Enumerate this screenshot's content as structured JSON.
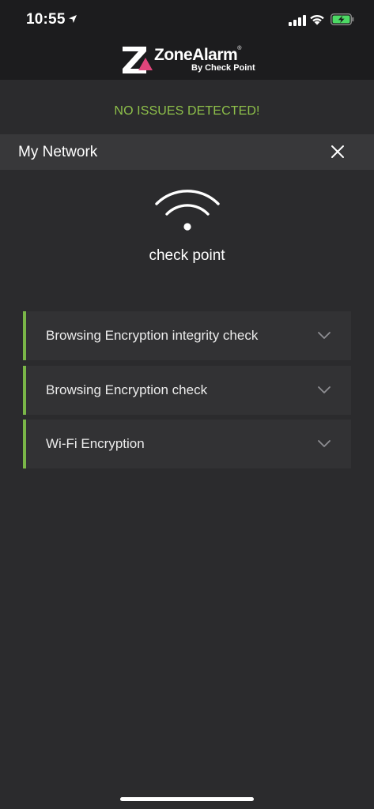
{
  "status_bar": {
    "time": "10:55",
    "location_icon": "location-arrow-icon",
    "signal_icon": "cellular-signal-icon",
    "wifi_icon": "wifi-icon",
    "battery_icon": "battery-charging-icon",
    "battery_color": "#4cd964"
  },
  "header": {
    "logo_name": "ZoneAlarm",
    "logo_tm": "®",
    "logo_byline": "By Check Point",
    "logo_accent": "#e0457b"
  },
  "status": {
    "message": "NO ISSUES DETECTED!",
    "color": "#8ec04a"
  },
  "section": {
    "title": "My Network",
    "close_icon": "close-icon"
  },
  "network": {
    "icon": "wifi-icon",
    "name": "check point"
  },
  "checks": [
    {
      "label": "Browsing Encryption integrity check",
      "icon": "chevron-down-icon"
    },
    {
      "label": "Browsing Encryption check",
      "icon": "chevron-down-icon"
    },
    {
      "label": "Wi-Fi Encryption",
      "icon": "chevron-down-icon"
    }
  ],
  "colors": {
    "background": "#2b2b2d",
    "header": "#1c1c1e",
    "section_header": "#38383a",
    "card": "#323234",
    "accent_green": "#7ab648"
  }
}
